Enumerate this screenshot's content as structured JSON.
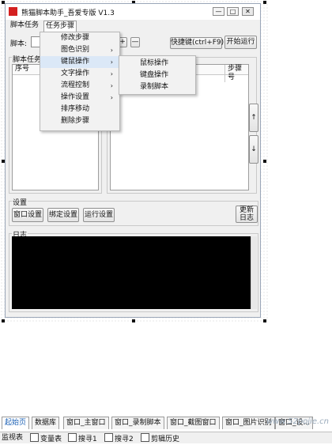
{
  "window": {
    "title": "熊猫脚本助手_吾爱专版  V1.3",
    "min_glyph": "—",
    "max_glyph": "□",
    "close_glyph": "✕"
  },
  "tabs": [
    {
      "label": "脚本任务"
    },
    {
      "label": "任务步骤"
    }
  ],
  "script_row": {
    "label": "脚本:",
    "input_value": "",
    "plus": "+",
    "minus": "—"
  },
  "hotkey_button": "快捷键(ctrl+F9)",
  "run_button": "开始运行",
  "left_group": {
    "title": "脚本任务",
    "column": "序号"
  },
  "right_list": {
    "column": "步骤号"
  },
  "up_button": "↑",
  "down_button": "↓",
  "context_menu": {
    "items": [
      {
        "label": "修改步骤",
        "arrow": ""
      },
      {
        "label": "图色识别",
        "arrow": "›"
      },
      {
        "label": "键鼠操作",
        "arrow": "›"
      },
      {
        "label": "文字操作",
        "arrow": "›"
      },
      {
        "label": "流程控制",
        "arrow": "›"
      },
      {
        "label": "操作设置",
        "arrow": "›"
      },
      {
        "label": "排序移动",
        "arrow": ""
      },
      {
        "label": "删除步骤",
        "arrow": ""
      }
    ]
  },
  "submenu": {
    "items": [
      {
        "label": "鼠标操作"
      },
      {
        "label": "键盘操作"
      },
      {
        "label": "录制脚本"
      }
    ]
  },
  "settings": {
    "title": "设置",
    "buttons": [
      "窗口设置",
      "绑定设置",
      "运行设置"
    ],
    "update_log": "更新\n日志"
  },
  "log": {
    "title": "日志"
  },
  "bottom_tabs": [
    {
      "label": "起始页"
    },
    {
      "label": "数据库"
    },
    {
      "label": "窗口_主窗口"
    },
    {
      "label": "窗口_录制脚本"
    },
    {
      "label": "窗口_截图窗口"
    },
    {
      "label": "窗口_图片识别"
    },
    {
      "label": "窗口_设..."
    }
  ],
  "status_bar": [
    {
      "label": "监视表",
      "icon": "monitor-icon"
    },
    {
      "label": "变量表",
      "icon": "variables-icon"
    },
    {
      "label": "搜寻1",
      "icon": "search1-icon"
    },
    {
      "label": "搜寻2",
      "icon": "search2-icon"
    },
    {
      "label": "剪辑历史",
      "icon": "clip-history-icon"
    }
  ],
  "watermark": "www.52pojie.cn",
  "colors": {
    "log_background": "#000000",
    "app_icon": "#d42020",
    "active_tab_text": "#1a5fb4"
  }
}
